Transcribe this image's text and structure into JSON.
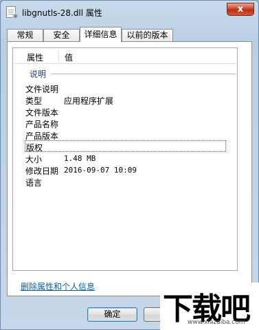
{
  "window": {
    "title": "libgnutls-28.dll 属性",
    "close_label": "x",
    "icon": "dll-file-icon"
  },
  "tabs": [
    {
      "label": "常规",
      "active": false
    },
    {
      "label": "安全",
      "active": false
    },
    {
      "label": "详细信息",
      "active": true
    },
    {
      "label": "以前的版本",
      "active": false
    }
  ],
  "details": {
    "header": {
      "property": "属性",
      "value": "值"
    },
    "group": "说明",
    "rows": [
      {
        "key": "文件说明",
        "value": ""
      },
      {
        "key": "类型",
        "value": "应用程序扩展"
      },
      {
        "key": "文件版本",
        "value": ""
      },
      {
        "key": "产品名称",
        "value": ""
      },
      {
        "key": "产品版本",
        "value": ""
      },
      {
        "key": "版权",
        "value": ""
      },
      {
        "key": "大小",
        "value": "1.48 MB"
      },
      {
        "key": "修改日期",
        "value": "2016-09-07 10:09"
      },
      {
        "key": "语言",
        "value": ""
      }
    ]
  },
  "remove_link": "删除属性和个人信息",
  "buttons": {
    "ok": "确定",
    "cancel": "取"
  },
  "watermark": {
    "text": "下载吧",
    "url": "www.xiazaiba.com"
  }
}
